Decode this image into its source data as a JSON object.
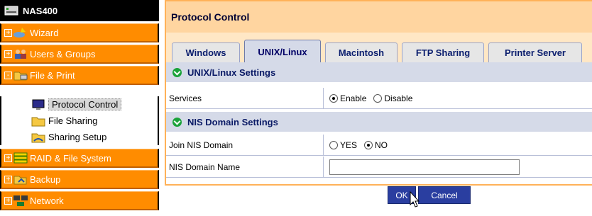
{
  "sidebar": {
    "device": "NAS400",
    "items": [
      {
        "label": "Wizard",
        "icon": "wizard-icon",
        "toggle": "+"
      },
      {
        "label": "Users & Groups",
        "icon": "users-groups-icon",
        "toggle": "+"
      },
      {
        "label": "File & Print",
        "icon": "file-print-icon",
        "toggle": "-"
      },
      {
        "label": "RAID & File System",
        "icon": "raid-icon",
        "toggle": "+"
      },
      {
        "label": "Backup",
        "icon": "backup-icon",
        "toggle": "+"
      },
      {
        "label": "Network",
        "icon": "network-icon",
        "toggle": "+"
      }
    ],
    "subitems": [
      {
        "label": "Protocol Control",
        "icon": "monitor-icon"
      },
      {
        "label": "File Sharing",
        "icon": "folder-icon"
      },
      {
        "label": "Sharing Setup",
        "icon": "shared-folder-icon"
      }
    ]
  },
  "main": {
    "title": "Protocol Control",
    "tabs": [
      "Windows",
      "UNIX/Linux",
      "Macintosh",
      "FTP Sharing",
      "Printer Server"
    ],
    "active_tab": "UNIX/Linux",
    "sections": [
      {
        "header": "UNIX/Linux Settings",
        "rows": [
          {
            "label": "Services",
            "options": [
              "Enable",
              "Disable"
            ],
            "selected": "Enable"
          }
        ]
      },
      {
        "header": "NIS Domain Settings",
        "rows": [
          {
            "label": "Join NIS Domain",
            "options": [
              "YES",
              "NO"
            ],
            "selected": "NO"
          },
          {
            "label": "NIS Domain Name",
            "value": ""
          }
        ]
      }
    ],
    "buttons": {
      "ok": "OK",
      "cancel": "Cancel"
    }
  },
  "colors": {
    "nav_orange": "#ff8c00",
    "title_bar": "#ffd5a0",
    "section_header": "#d5dae8",
    "button_blue": "#2a3ea0"
  }
}
